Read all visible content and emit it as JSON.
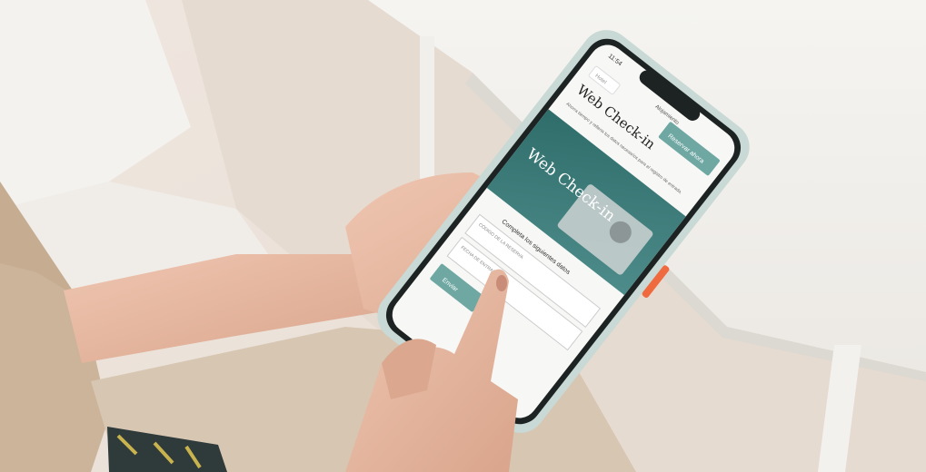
{
  "phone": {
    "status_time": "11:54",
    "top_bar_label": "Alojamiento",
    "logo_text": "Hotel",
    "action_button": "Reservar ahora",
    "page_heading": "Web Check-in",
    "intro_text": "Ahorra tiempo y rellena tus datos necesarios para el registro de entrada.",
    "banner_text": "Web Check-in",
    "form_prompt": "Completa los siguientes datos",
    "field_booking_code": "CÓDIGO DE LA RESERVA",
    "field_arrival_date": "FECHA DE ENTRADA",
    "submit_button": "Enviar"
  },
  "colors": {
    "phone_case": "#c9d9d5",
    "accent_teal": "#6fa7a3",
    "orange_button": "#f06a3f",
    "screen_bg": "#f7f7f5",
    "table_white": "#f3f1ee",
    "skin": "#e7b9a2",
    "sweater": "#cbb49a"
  }
}
